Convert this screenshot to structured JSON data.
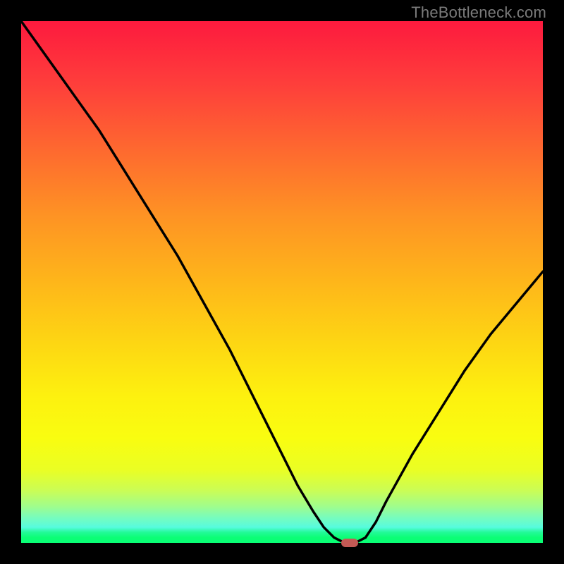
{
  "watermark": "TheBottleneck.com",
  "colors": {
    "marker": "#c35a55",
    "curve": "#000000",
    "frame": "#000000"
  },
  "chart_data": {
    "type": "line",
    "title": "",
    "xlabel": "",
    "ylabel": "",
    "xlim": [
      0,
      100
    ],
    "ylim": [
      0,
      100
    ],
    "x": [
      0,
      5,
      10,
      15,
      20,
      25,
      30,
      35,
      40,
      45,
      50,
      53,
      56,
      58,
      60,
      62,
      64,
      66,
      68,
      70,
      75,
      80,
      85,
      90,
      95,
      100
    ],
    "values": [
      100,
      93,
      86,
      79,
      71,
      63,
      55,
      46,
      37,
      27,
      17,
      11,
      6,
      3,
      1,
      0,
      0,
      1,
      4,
      8,
      17,
      25,
      33,
      40,
      46,
      52
    ],
    "marker": {
      "x": 63,
      "y": 0
    },
    "grid": false,
    "legend": null
  }
}
